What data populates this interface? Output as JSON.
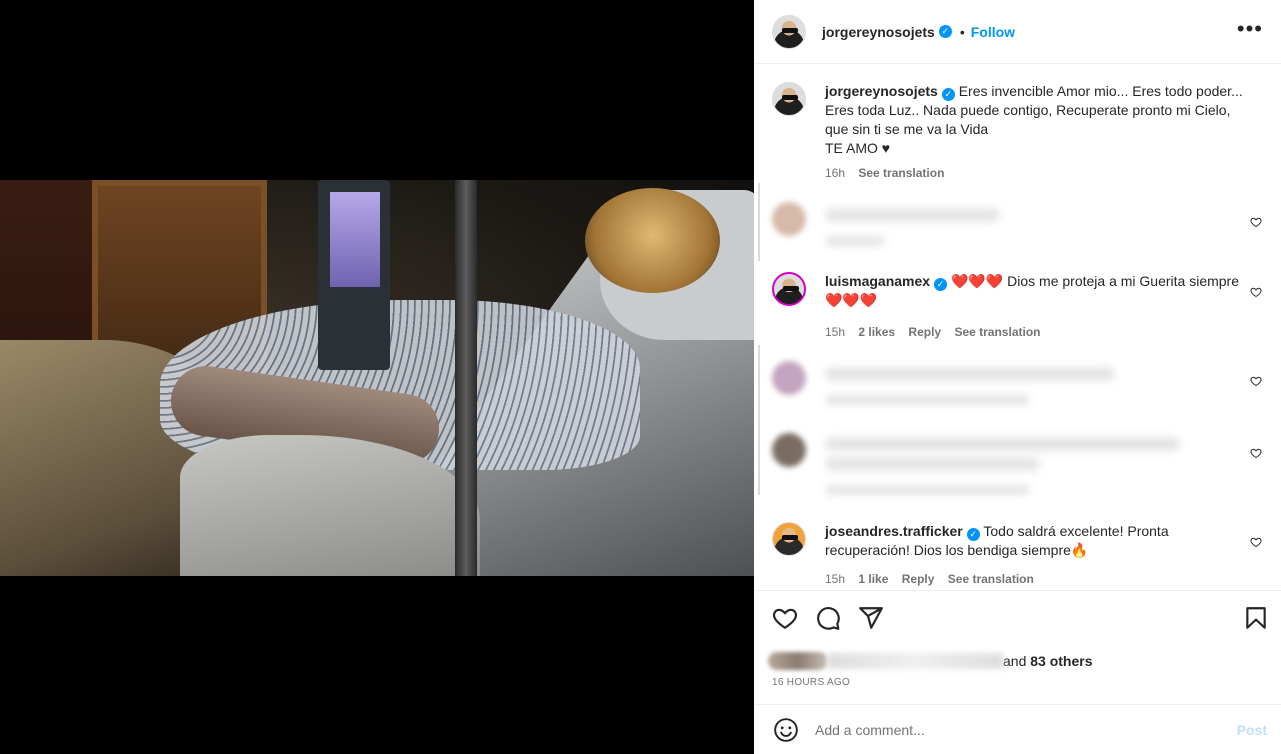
{
  "post": {
    "username": "jorgereynosojets",
    "follow_label": "Follow",
    "separator": "•",
    "more_label": "•••",
    "verified_mark": "✓",
    "caption_line1": "Eres invencible Amor mio... Eres todo poder... Eres toda Luz.. Nada puede contigo, Recuperate pronto mi Cielo, que sin ti se me va la Vida",
    "caption_line2": "TE AMO ♥",
    "caption_time": "16h",
    "caption_translate": "See translation"
  },
  "comments": [
    {
      "username": "luismaganamex",
      "text": "❤️❤️❤️ Dios me proteja a mi Guerita siempre ❤️❤️❤️",
      "time": "15h",
      "likes": "2 likes",
      "reply": "Reply",
      "translate": "See translation"
    },
    {
      "username": "joseandres.trafficker",
      "text": "Todo saldrá excelente! Pronta recuperación! Dios los bendiga siempre🔥",
      "time": "15h",
      "likes": "1 like",
      "reply": "Reply",
      "translate": "See translation"
    }
  ],
  "likes": {
    "and_label": "and",
    "count": "83 others"
  },
  "timestamp": "16 HOURS AGO",
  "composer": {
    "placeholder": "Add a comment...",
    "post_label": "Post"
  },
  "icons": {
    "like": "heart-icon",
    "comment": "comment-bubble-icon",
    "share": "paper-plane-icon",
    "save": "bookmark-icon",
    "emoji": "smiley-icon",
    "more": "more-horizontal-icon",
    "verified": "verified-badge-icon"
  },
  "colors": {
    "accent": "#0095f6",
    "text": "#262626",
    "muted": "#737373"
  }
}
